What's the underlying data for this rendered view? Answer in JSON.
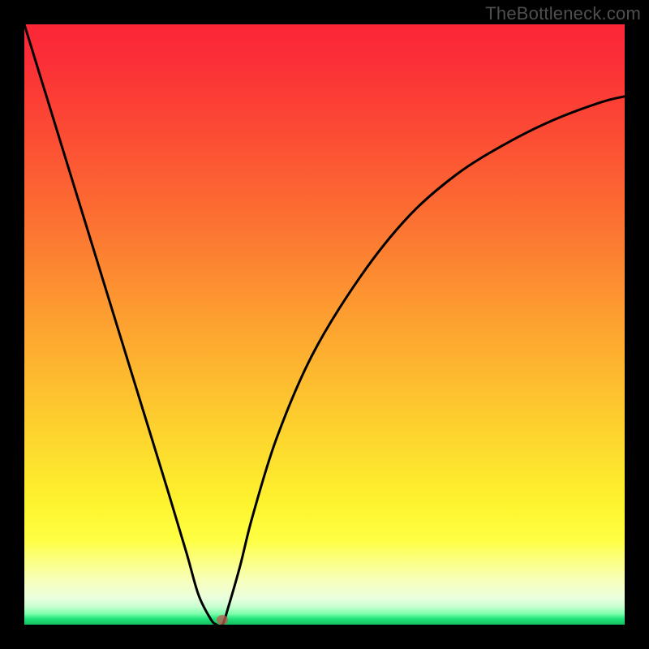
{
  "watermark": {
    "text": "TheBottleneck.com"
  },
  "chart_data": {
    "type": "line",
    "title": "",
    "xlabel": "",
    "ylabel": "",
    "xlim": [
      0,
      100
    ],
    "ylim": [
      0,
      100
    ],
    "grid": false,
    "legend": false,
    "series": [
      {
        "name": "bottleneck-curve",
        "x": [
          0,
          4,
          8,
          12,
          16,
          20,
          24,
          27,
          29,
          31,
          32,
          33,
          34,
          36,
          38,
          42,
          48,
          56,
          64,
          72,
          80,
          88,
          96,
          100
        ],
        "values": [
          100,
          87,
          74,
          61,
          48,
          35,
          22,
          12,
          5,
          1,
          0,
          0,
          3,
          10,
          18,
          31,
          45,
          58,
          68,
          75,
          80,
          84,
          87,
          88
        ]
      }
    ],
    "annotations": [
      {
        "name": "min-marker",
        "x": 33.0,
        "y": 0.8,
        "color": "#c15a53"
      }
    ],
    "background_gradient": {
      "direction": "vertical",
      "stops": [
        {
          "pos": 0.0,
          "color": "#fb2637"
        },
        {
          "pos": 0.45,
          "color": "#fd9430"
        },
        {
          "pos": 0.8,
          "color": "#fef42e"
        },
        {
          "pos": 0.93,
          "color": "#f7ffc0"
        },
        {
          "pos": 0.99,
          "color": "#22e57a"
        },
        {
          "pos": 1.0,
          "color": "#12c060"
        }
      ]
    }
  }
}
